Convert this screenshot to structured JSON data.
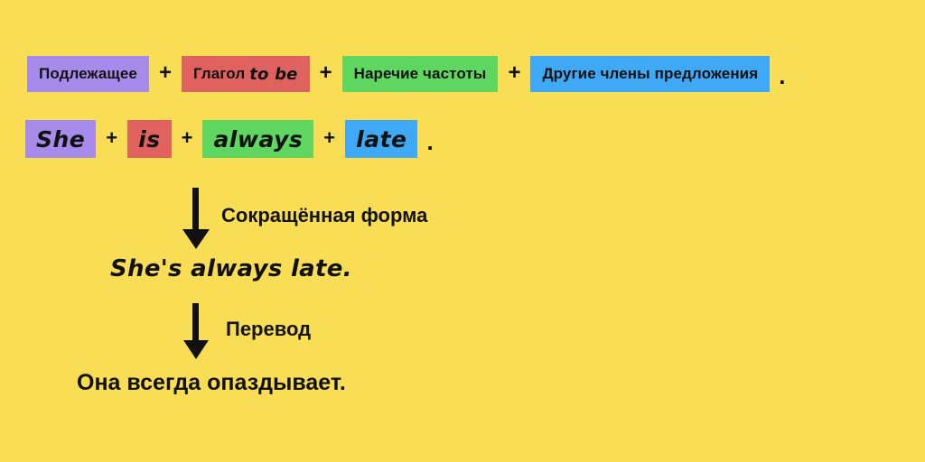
{
  "background_color": "#f9dd55",
  "colors": {
    "purple": "#a78bea",
    "red": "#e0625f",
    "green": "#5fd65f",
    "blue": "#3fa9f5",
    "text": "#111111"
  },
  "formula_row": {
    "parts": [
      {
        "label": "Подлежащее",
        "color": "purple"
      },
      {
        "label": "Глагол",
        "label_extra": "to be",
        "color": "red"
      },
      {
        "label": "Наречие частоты",
        "color": "green"
      },
      {
        "label": "Другие члены предложения",
        "color": "blue"
      }
    ],
    "separator": "+",
    "terminator": "."
  },
  "example_row": {
    "parts": [
      {
        "label": "She",
        "color": "purple"
      },
      {
        "label": "is",
        "color": "red"
      },
      {
        "label": "always",
        "color": "green"
      },
      {
        "label": "late",
        "color": "blue"
      }
    ],
    "separator": "+",
    "terminator": "."
  },
  "steps": {
    "contracted": {
      "arrow_label": "Сокращённая форма",
      "result": "She's always late."
    },
    "translation": {
      "arrow_label": "Перевод",
      "result": "Она всегда опаздывает."
    }
  }
}
